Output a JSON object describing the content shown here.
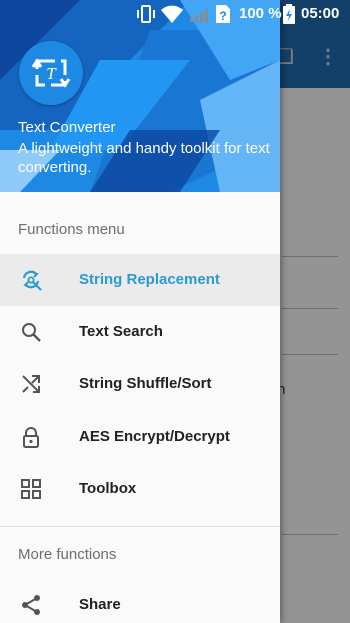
{
  "status_bar": {
    "battery_percent": "100 %",
    "time": "05:00"
  },
  "drawer": {
    "app_name": "Text Converter",
    "app_description": "A lightweight and handy toolkit for text converting.",
    "functions_section_title": "Functions menu",
    "menu_items": [
      {
        "label": "String Replacement",
        "icon": "replace-icon",
        "active": true
      },
      {
        "label": "Text Search",
        "icon": "search-icon",
        "active": false
      },
      {
        "label": "String Shuffle/Sort",
        "icon": "shuffle-icon",
        "active": false
      },
      {
        "label": "AES Encrypt/Decrypt",
        "icon": "lock-icon",
        "active": false
      },
      {
        "label": "Toolbox",
        "icon": "grid-icon",
        "active": false
      }
    ],
    "more_section_title": "More functions",
    "more_items": [
      {
        "label": "Share",
        "icon": "share-icon"
      }
    ]
  },
  "background_app": {
    "visible_text": "n"
  },
  "colors": {
    "accent": "#2a9ad6",
    "header": "#1e88e5",
    "toolbar": "#1f6fb3"
  }
}
